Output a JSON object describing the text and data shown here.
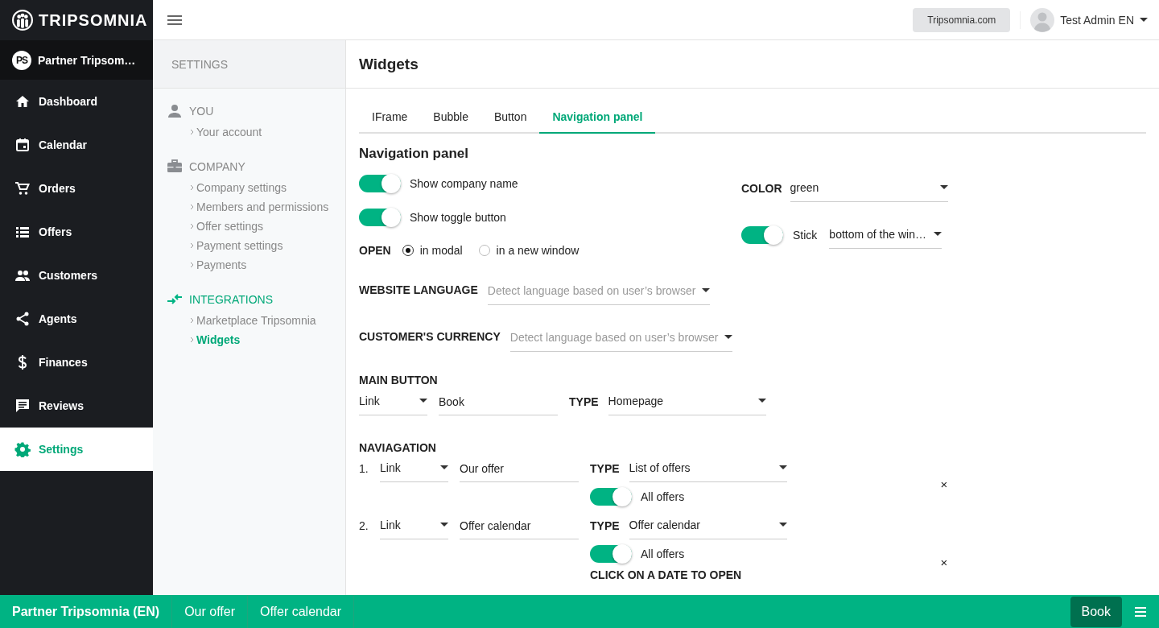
{
  "brand": {
    "name": "TRIPSOMNIA"
  },
  "account": {
    "initials": "PS",
    "name": "Partner Tripsom…"
  },
  "nav": [
    {
      "label": "Dashboard",
      "selected": false
    },
    {
      "label": "Calendar",
      "selected": false
    },
    {
      "label": "Orders",
      "selected": false
    },
    {
      "label": "Offers",
      "selected": false
    },
    {
      "label": "Customers",
      "selected": false
    },
    {
      "label": "Agents",
      "selected": false
    },
    {
      "label": "Finances",
      "selected": false
    },
    {
      "label": "Reviews",
      "selected": false
    },
    {
      "label": "Settings",
      "selected": true
    }
  ],
  "topbar": {
    "site_button": "Tripsomnia.com",
    "user": "Test Admin EN"
  },
  "settings": {
    "title": "SETTINGS",
    "sections": [
      {
        "label": "YOU",
        "selected": false,
        "items": [
          {
            "label": "Your account",
            "selected": false
          }
        ]
      },
      {
        "label": "COMPANY",
        "selected": false,
        "items": [
          {
            "label": "Company settings",
            "selected": false
          },
          {
            "label": "Members and permissions",
            "selected": false
          },
          {
            "label": "Offer settings",
            "selected": false
          },
          {
            "label": "Payment settings",
            "selected": false
          },
          {
            "label": "Payments",
            "selected": false
          }
        ]
      },
      {
        "label": "INTEGRATIONS",
        "selected": true,
        "items": [
          {
            "label": "Marketplace Tripsomnia",
            "selected": false
          },
          {
            "label": "Widgets",
            "selected": true
          }
        ]
      }
    ]
  },
  "page": {
    "title": "Widgets"
  },
  "tabs": [
    {
      "label": "IFrame",
      "selected": false
    },
    {
      "label": "Bubble",
      "selected": false
    },
    {
      "label": "Button",
      "selected": false
    },
    {
      "label": "Navigation panel",
      "selected": true
    }
  ],
  "panel": {
    "heading": "Navigation panel",
    "toggles": [
      {
        "label": "Show company name",
        "on": true
      },
      {
        "label": "Show toggle button",
        "on": true
      }
    ],
    "open": {
      "label": "OPEN",
      "options": [
        {
          "label": "in modal",
          "selected": true
        },
        {
          "label": "in a new window",
          "selected": false
        }
      ]
    },
    "color": {
      "label": "COLOR",
      "value": "green"
    },
    "stick": {
      "on": true,
      "label": "Stick",
      "value": "bottom of the win…"
    },
    "website_language": {
      "label": "WEBSITE LANGUAGE",
      "placeholder": "Detect language based on user’s browser"
    },
    "currency": {
      "label": "CUSTOMER'S CURRENCY",
      "placeholder": "Detect language based on user’s browser"
    },
    "main_button": {
      "label": "MAIN BUTTON",
      "link": "Link",
      "text": "Book",
      "type_label": "TYPE",
      "type": "Homepage"
    },
    "navigation": {
      "label": "NAVIAGATION",
      "items": [
        {
          "number": "1.",
          "link": "Link",
          "text": "Our offer",
          "type_label": "TYPE",
          "type": "List of offers",
          "toggle": {
            "on": true,
            "label": "All offers"
          },
          "remove": "×"
        },
        {
          "number": "2.",
          "link": "Link",
          "text": "Offer calendar",
          "type_label": "TYPE",
          "type": "Offer calendar",
          "toggle": {
            "on": true,
            "label": "All offers"
          },
          "note": "CLICK ON A DATE TO OPEN",
          "remove": "×"
        }
      ]
    }
  },
  "preview_bar": {
    "items": [
      {
        "label": "Partner Tripsomnia (EN)",
        "kind": "title"
      },
      {
        "label": "Our offer",
        "kind": "link"
      },
      {
        "label": "Offer calendar",
        "kind": "link"
      }
    ],
    "book": "Book"
  }
}
